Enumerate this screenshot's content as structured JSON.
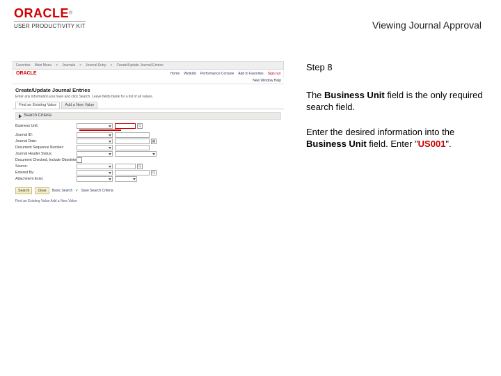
{
  "header": {
    "vendor": "ORACLE",
    "trademark": "®",
    "subline": "USER PRODUCTIVITY KIT",
    "doc_title": "Viewing Journal Approval"
  },
  "instructions": {
    "step_label": "Step 8",
    "text1_pre": "The ",
    "text1_bold": "Business Unit",
    "text1_post": " field is the only required search field.",
    "text2_pre": "Enter the desired information into the ",
    "text2_bold": "Business Unit",
    "text2_mid": " field. Enter \"",
    "text2_value": "US001",
    "text2_post": "\"."
  },
  "mini": {
    "breadcrumb": [
      "Favorites",
      "Main Menu",
      "Journals",
      "Journal Entry",
      "Create/Update Journal Entries"
    ],
    "brand": "ORACLE",
    "nav_links": [
      "Home",
      "Worklist",
      "Performance Console",
      "Add to Favorites",
      "Sign out"
    ],
    "person_text": "New Window   Help",
    "page_title": "Create/Update Journal Entries",
    "subtitle": "Enter any information you have and click Search. Leave fields blank for a list of all values.",
    "tabs": {
      "active": "Find an Existing Value",
      "other": "Add a New Value"
    },
    "section": "Search Criteria",
    "fields": [
      "Business Unit:",
      "Journal ID:",
      "Journal Date:",
      "Document Sequence Number:",
      "Journal Header Status:",
      "Document Checked, Include Obsolete:",
      "Source:",
      "Entered By:",
      "Attachment Exist:"
    ],
    "buttons": {
      "search": "Search",
      "clear": "Clear",
      "basic": "Basic Search",
      "save": "Save Search Criteria"
    },
    "footer": "Find an Existing Value   Add a New Value"
  }
}
